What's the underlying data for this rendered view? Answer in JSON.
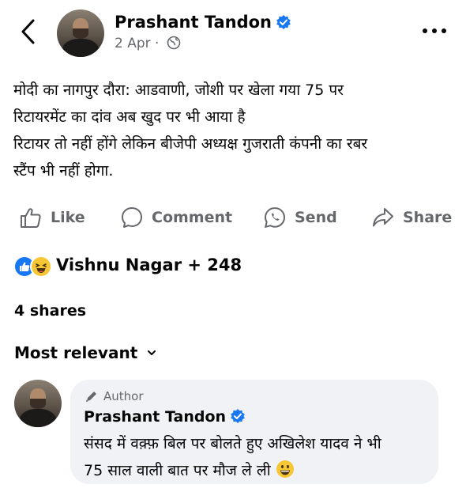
{
  "header": {
    "author_name": "Prashant Tandon",
    "timestamp": "2 Apr",
    "separator": "·",
    "icons": [
      "back-chevron-icon",
      "verified-badge-icon",
      "globe-icon",
      "more-options-icon"
    ]
  },
  "post": {
    "text": "मोदी का नागपुर दौरा: आडवाणी, जोशी पर खेला गया 75 पर\nरिटायरमेंट का दांव अब खुद पर भी आया है\nरिटायर तो नहीं होंगे लेकिन बीजेपी अध्यक्ष गुजराती कंपनी का रबर\nस्टैंप भी नहीं होगा."
  },
  "actions": {
    "like": "Like",
    "comment": "Comment",
    "send": "Send",
    "share": "Share"
  },
  "reactions": {
    "summary": "Vishnu Nagar + 248",
    "icons": [
      "like-reaction-icon",
      "haha-reaction-icon"
    ]
  },
  "shares": "4 shares",
  "sort_label": "Most relevant",
  "comment": {
    "badge": "Author",
    "author_name": "Prashant Tandon",
    "text": "संसद में वक़्फ़ बिल पर बोलते हुए अखिलेश यादव ने भी\n75 साल वाली बात पर मौज ले ली"
  },
  "colors": {
    "accent_blue": "#1877f2",
    "secondary_text": "#65676b",
    "bubble_bg": "#f0f2f5"
  }
}
